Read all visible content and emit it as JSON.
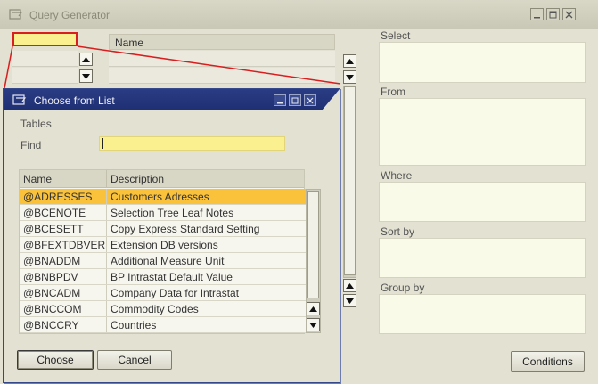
{
  "main": {
    "title": "Query Generator",
    "table_header_name": "Name",
    "labels": {
      "select": "Select",
      "from": "From",
      "where": "Where",
      "sort_by": "Sort by",
      "group_by": "Group by"
    },
    "conditions_button": "Conditions"
  },
  "dialog": {
    "title": "Choose from List",
    "tables_label": "Tables",
    "find_label": "Find",
    "find_value": "",
    "columns": [
      "Name",
      "Description"
    ],
    "rows": [
      {
        "name": "@ADRESSES",
        "description": "Customers Adresses",
        "selected": true
      },
      {
        "name": "@BCENOTE",
        "description": "Selection Tree Leaf Notes"
      },
      {
        "name": "@BCESETT",
        "description": "Copy Express Standard Setting"
      },
      {
        "name": "@BFEXTDBVERSI",
        "description": "Extension DB versions"
      },
      {
        "name": "@BNADDM",
        "description": "Additional Measure Unit"
      },
      {
        "name": "@BNBPDV",
        "description": "BP Intrastat Default Value"
      },
      {
        "name": "@BNCADM",
        "description": "Company Data for Intrastat"
      },
      {
        "name": "@BNCCOM",
        "description": "Commodity Codes"
      },
      {
        "name": "@BNCCRY",
        "description": "Countries"
      }
    ],
    "choose_button": "Choose",
    "cancel_button": "Cancel"
  },
  "colors": {
    "title_bar_active": "#1f2f73",
    "selection": "#f9c23a",
    "highlight_border": "#d81e1e",
    "input_bg": "#fbf08f"
  }
}
